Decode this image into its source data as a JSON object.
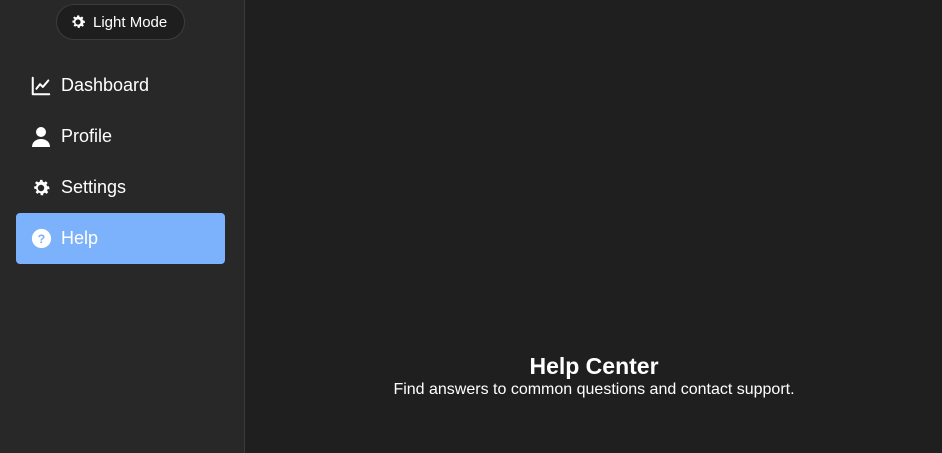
{
  "theme_toggle": {
    "label": "Light Mode",
    "icon": "gear-icon"
  },
  "sidebar": {
    "items": [
      {
        "label": "Dashboard",
        "icon": "chart-line-icon",
        "active": false
      },
      {
        "label": "Profile",
        "icon": "user-icon",
        "active": false
      },
      {
        "label": "Settings",
        "icon": "gear-icon",
        "active": false
      },
      {
        "label": "Help",
        "icon": "question-circle-icon",
        "active": true
      }
    ]
  },
  "main": {
    "title": "Help Center",
    "subtitle": "Find answers to common questions and contact support."
  },
  "colors": {
    "sidebar_bg": "#282828",
    "main_bg": "#1f1f1f",
    "active_item": "#7cb1fb",
    "text": "#ffffff"
  }
}
